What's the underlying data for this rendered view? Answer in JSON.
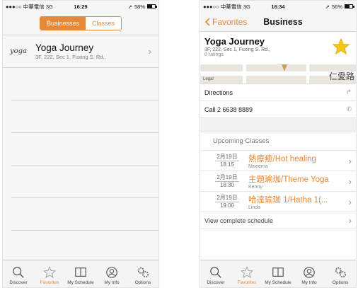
{
  "colors": {
    "accent": "#e4883a",
    "star": "#f5c518",
    "divider": "#d3d3d3"
  },
  "screen1": {
    "status": {
      "carrier": "●●●○○ 中華電信 3G",
      "time": "16:29",
      "battery_text": "58%",
      "battery_level": 0.58
    },
    "segments": [
      {
        "label": "Businesses",
        "active": true
      },
      {
        "label": "Classes",
        "active": false
      }
    ],
    "list": [
      {
        "logo": "yoga",
        "name": "Yoga Journey",
        "address": "3F, 222, Sec 1, Fuxing S. Rd.,"
      }
    ]
  },
  "screen2": {
    "status": {
      "carrier": "●●●○○ 中華電信 3G",
      "time": "16:34",
      "battery_text": "56%",
      "battery_level": 0.56
    },
    "nav": {
      "back_label": "Favorites",
      "title": "Business"
    },
    "business": {
      "name": "Yoga Journey",
      "address": "3F, 222, Sec 1, Fuxing S. Rd.,",
      "ratings": "0 ratings",
      "favorited": true
    },
    "map": {
      "legal": "Legal",
      "area": "仁愛路"
    },
    "directions_label": "Directions",
    "call_label": "Call 2 6638 8889",
    "upcoming_header": "Upcoming Classes",
    "classes": [
      {
        "date": "2月19日",
        "time": "18:15",
        "title": "熱療癒/Hot healing",
        "instructor": "Niseema"
      },
      {
        "date": "2月19日",
        "time": "18:30",
        "title": "主題瑜珈/Theme Yoga",
        "instructor": "Kenny"
      },
      {
        "date": "2月19日",
        "time": "19:00",
        "title": "哈達瑜珈 1/Hatha 1(...",
        "instructor": "Linda"
      }
    ],
    "view_schedule_label": "View complete schedule"
  },
  "tabbar": [
    {
      "label": "Discover",
      "icon": "search-icon"
    },
    {
      "label": "Favorites",
      "icon": "star-icon"
    },
    {
      "label": "My Schedule",
      "icon": "book-icon"
    },
    {
      "label": "My Info",
      "icon": "profile-icon"
    },
    {
      "label": "Options",
      "icon": "gear-icon"
    }
  ],
  "screen1_active_tab": 1,
  "screen2_active_tab": 1
}
